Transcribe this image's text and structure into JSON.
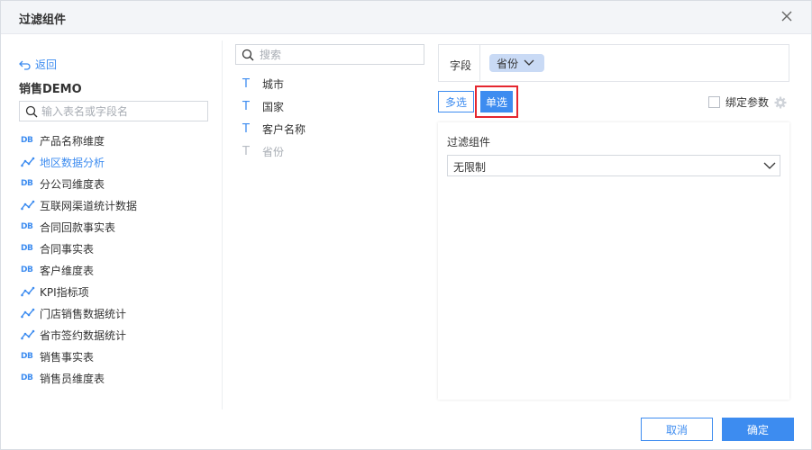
{
  "dialog": {
    "title": "过滤组件"
  },
  "left": {
    "back_label": "返回",
    "package_name": "销售DEMO",
    "search_placeholder": "输入表名或字段名",
    "tables": [
      {
        "type": "db",
        "label": "产品名称维度"
      },
      {
        "type": "analysis",
        "label": "地区数据分析",
        "active": true
      },
      {
        "type": "db",
        "label": "分公司维度表"
      },
      {
        "type": "analysis",
        "label": "互联网渠道统计数据"
      },
      {
        "type": "db",
        "label": "合同回款事实表"
      },
      {
        "type": "db",
        "label": "合同事实表"
      },
      {
        "type": "db",
        "label": "客户维度表"
      },
      {
        "type": "analysis",
        "label": "KPI指标项"
      },
      {
        "type": "analysis",
        "label": "门店销售数据统计"
      },
      {
        "type": "analysis",
        "label": "省市签约数据统计"
      },
      {
        "type": "db",
        "label": "销售事实表"
      },
      {
        "type": "db",
        "label": "销售员维度表"
      }
    ],
    "db_icon_text": "DB"
  },
  "middle": {
    "search_placeholder": "搜索",
    "fields": [
      {
        "label": "城市",
        "disabled": false
      },
      {
        "label": "国家",
        "disabled": false
      },
      {
        "label": "客户名称",
        "disabled": false
      },
      {
        "label": "省份",
        "disabled": true
      }
    ],
    "type_icon": "T"
  },
  "right": {
    "field_label": "字段",
    "field_tag": "省份",
    "multi_label": "多选",
    "single_label": "单选",
    "bind_label": "绑定参数",
    "panel_label": "过滤组件",
    "select_value": "无限制"
  },
  "footer": {
    "cancel_label": "取消",
    "ok_label": "确定"
  },
  "colors": {
    "accent": "#3d8cf0",
    "highlight": "#e5262f",
    "tag_bg": "#c9daf5"
  }
}
